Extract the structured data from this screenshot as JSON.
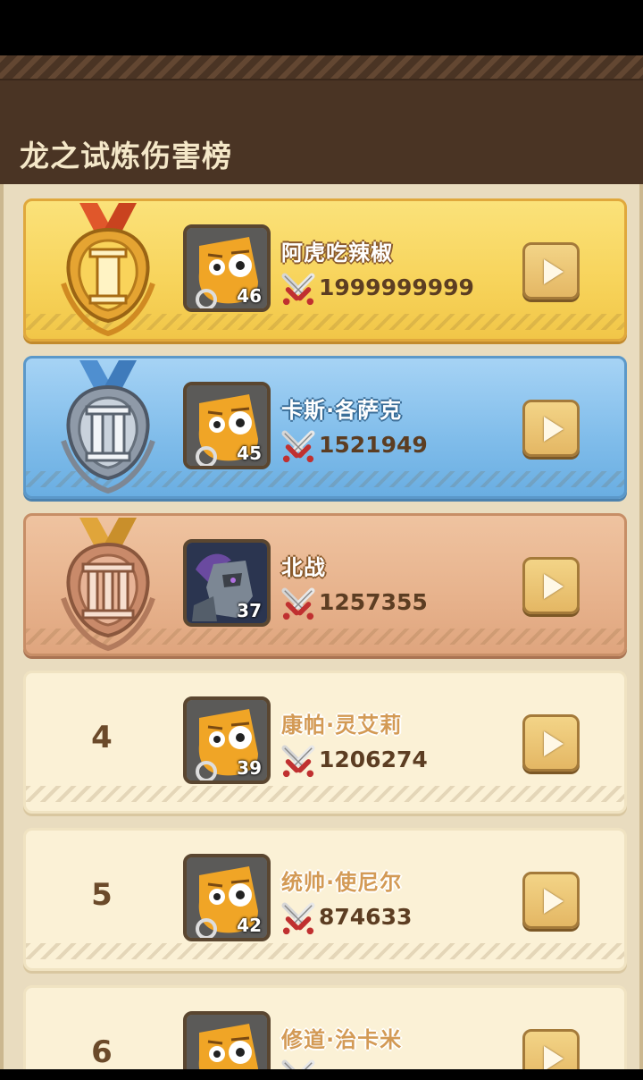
{
  "header": {
    "title": "龙之试炼伤害榜"
  },
  "ranking": [
    {
      "rank": "1",
      "tier": "gold",
      "name": "阿虎吃辣椒",
      "level": "46",
      "damage": "1999999999",
      "avatar": "orange-creature"
    },
    {
      "rank": "2",
      "tier": "silver",
      "name": "卡斯·各萨克",
      "level": "45",
      "damage": "1521949",
      "avatar": "orange-creature"
    },
    {
      "rank": "3",
      "tier": "bronze",
      "name": "北战",
      "level": "37",
      "damage": "1257355",
      "avatar": "dark-knight"
    },
    {
      "rank": "4",
      "tier": "plain",
      "name": "康帕·灵艾莉",
      "level": "39",
      "damage": "1206274",
      "avatar": "orange-creature"
    },
    {
      "rank": "5",
      "tier": "plain",
      "name": "统帅·使尼尔",
      "level": "42",
      "damage": "874633",
      "avatar": "orange-creature"
    },
    {
      "rank": "6",
      "tier": "plain",
      "name": "修道·治卡米",
      "level": "",
      "damage": "",
      "avatar": "orange-creature"
    }
  ],
  "colors": {
    "header_bg": "#4a3424",
    "gold": "#f7d35a",
    "silver": "#7fbcea",
    "bronze": "#e7b28c",
    "plain": "#fbf1d6"
  }
}
